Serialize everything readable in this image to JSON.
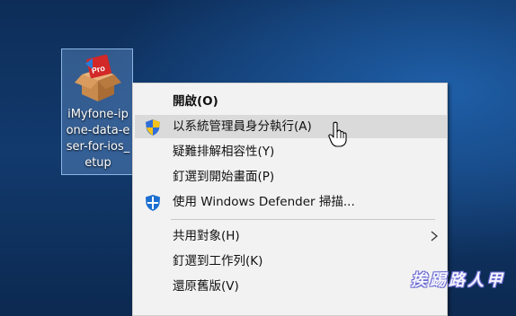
{
  "desktop": {
    "icon": {
      "name": "iMyfone-iphone-data-eraser-for-ios_setup",
      "label_lines": [
        "iMyfone-ip",
        "one-data-e",
        "ser-for-ios_",
        "etup"
      ],
      "badge": "Pro"
    }
  },
  "context_menu": {
    "items": [
      {
        "label": "開啟(O)"
      },
      {
        "label": "以系統管理員身分執行(A)",
        "icon": "uac-shield-icon"
      },
      {
        "label": "疑難排解相容性(Y)"
      },
      {
        "label": "釘選到開始畫面(P)"
      },
      {
        "label": "使用 Windows Defender 掃描...",
        "icon": "windows-defender-icon"
      },
      {
        "label": "共用對象(H)",
        "submenu": true
      },
      {
        "label": "釘選到工作列(K)"
      },
      {
        "label": "還原舊版(V)"
      }
    ],
    "hovered_index": 1,
    "colors": {
      "background": "#f2f2f2",
      "hover": "#dadada",
      "defender_blue": "#1c6fd1"
    }
  },
  "watermark": "挨踢路人甲"
}
